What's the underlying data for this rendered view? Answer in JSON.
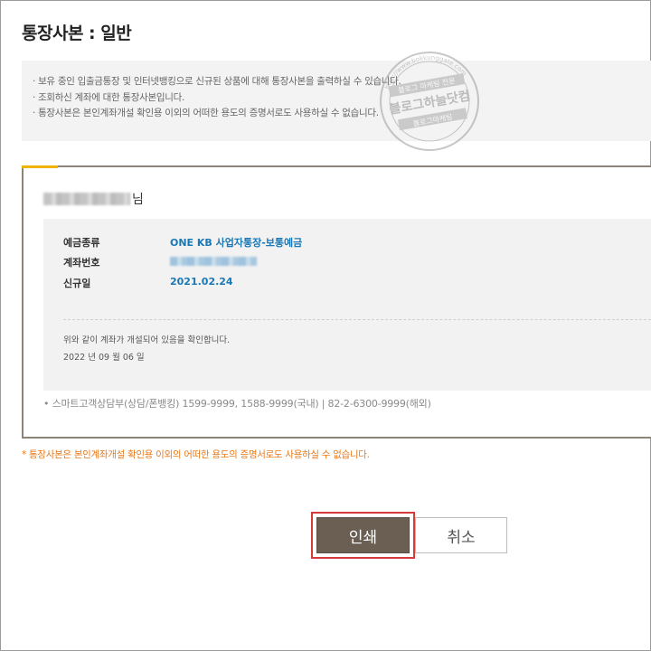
{
  "page": {
    "title": "통장사본 : 일반"
  },
  "notice": {
    "lines": [
      "· 보유 중인 입출금통장 및 인터넷뱅킹으로 신규된 상품에 대해 통장사본을 출력하실 수 있습니다.",
      "· 조회하신 계좌에 대한 통장사본입니다.",
      "· 통장사본은 본인계좌개설 확인용 이외의 어떠한 용도의 증명서로도 사용하실 수 없습니다."
    ]
  },
  "watermark": {
    "text_top": "http://www.bokkunggate.com",
    "text_mid": "블로그 마케팅 전문",
    "text_main": "블로그하늘닷컴",
    "text_bottom": "블로그마케팅"
  },
  "certificate": {
    "holder_suffix": "님",
    "fields": {
      "deposit_type_label": "예금종류",
      "deposit_type_value": "ONE KB 사업자통장-보통예금",
      "account_number_label": "계좌번호",
      "open_date_label": "신규일",
      "open_date_value": "2021.02.24"
    },
    "confirmation": "위와 같이 계좌가 개설되어 있음을 확인합니다.",
    "issue_date": "2022 년 09 월 06 일",
    "contact": "• 스마트고객상담부(상담/폰뱅킹) 1599-9999, 1588-9999(국내) | 82-2-6300-9999(해외)"
  },
  "warning": "* 통장사본은 본인계좌개설 확인용 이외의 어떠한 용도의 증명서로도 사용하실 수 없습니다.",
  "buttons": {
    "print_label": "인쇄",
    "cancel_label": "취소"
  },
  "colors": {
    "accent_brown": "#6b5f54",
    "value_blue": "#1a78b4",
    "warning_orange": "#e67a1c",
    "highlight_red": "#d63b3b",
    "tab_yellow": "#f0b400"
  }
}
